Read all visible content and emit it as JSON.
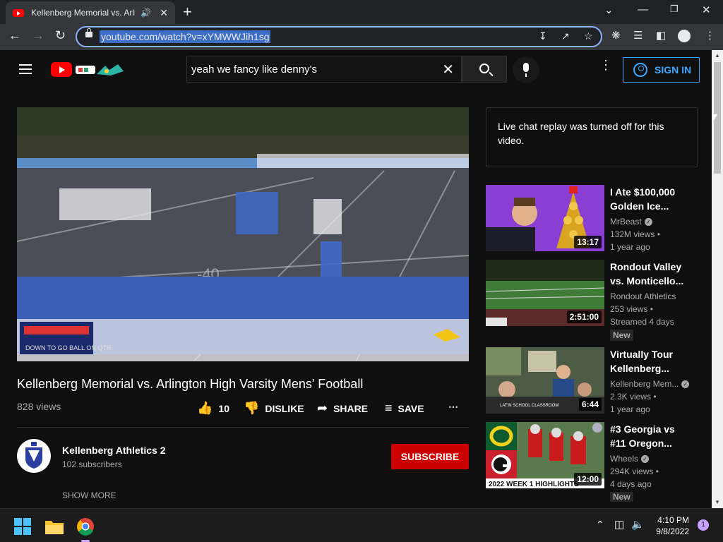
{
  "browser": {
    "tab_title": "Kellenberg Memorial vs. Arlington High Varsity Mens' Football",
    "url": "youtube.com/watch?v=xYMWWJih1sg"
  },
  "header": {
    "search_value": "yeah we fancy like denny's",
    "sign_in_label": "SIGN IN",
    "accent_color": "#3ea6ff",
    "brand_color": "#ff0000"
  },
  "video": {
    "title": "Kellenberg Memorial vs. Arlington High Varsity Mens' Football",
    "views": "828 views",
    "likes": "10",
    "dislike_label": "DISLIKE",
    "share_label": "SHARE",
    "save_label": "SAVE"
  },
  "channel": {
    "name": "Kellenberg Athletics 2",
    "subscribers": "102 subscribers",
    "subscribe_label": "SUBSCRIBE",
    "show_more_label": "SHOW MORE"
  },
  "chat": {
    "message": "Live chat replay was turned off for this video."
  },
  "recommendations": [
    {
      "title": "I Ate $100,000 Golden Ice...",
      "channel": "MrBeast",
      "verified": true,
      "views": "132M views",
      "age": "1 year ago",
      "duration": "13:17",
      "badge": ""
    },
    {
      "title": "Rondout Valley vs. Monticello...",
      "channel": "Rondout Athletics",
      "verified": false,
      "views": "253 views",
      "age": "Streamed 4 days",
      "duration": "2:51:00",
      "badge": "New"
    },
    {
      "title": "Virtually Tour Kellenberg...",
      "channel": "Kellenberg Mem...",
      "verified": true,
      "views": "2.3K views",
      "age": "1 year ago",
      "duration": "6:44",
      "badge": ""
    },
    {
      "title": "#3 Georgia vs #11 Oregon...",
      "channel": "Wheels",
      "verified": true,
      "views": "294K views",
      "age": "4 days ago",
      "duration": "12:00",
      "badge": "New"
    }
  ],
  "thumbnail_text": {
    "classroom": "LATIN SCHOOL CLASSROOM",
    "week": "2022 WEEK 1 HIGHLIGHTS"
  },
  "taskbar": {
    "time": "4:10 PM",
    "date": "9/8/2022",
    "notifications": "1"
  }
}
